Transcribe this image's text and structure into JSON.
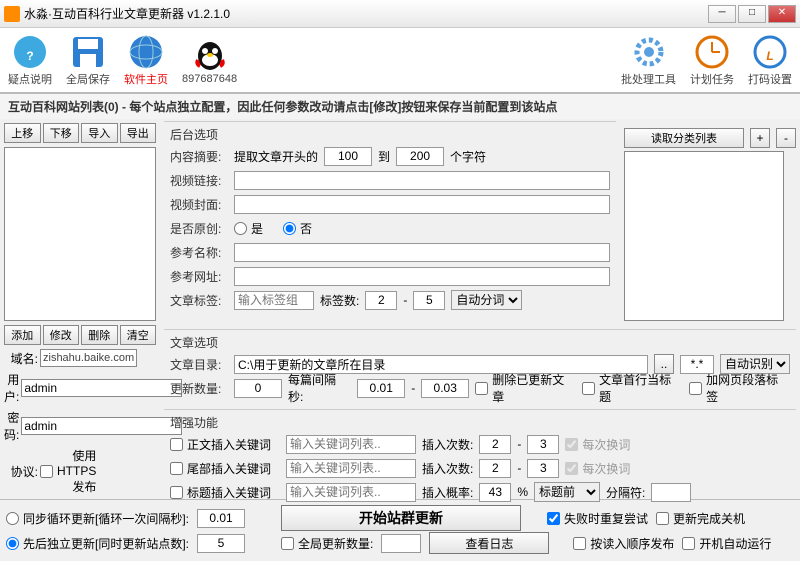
{
  "title": "水淼·互动百科行业文章更新器 v1.2.1.0",
  "toolbar": {
    "help": "疑点说明",
    "save": "全局保存",
    "home": "软件主页",
    "qq": "897687648",
    "batch": "批处理工具",
    "schedule": "计划任务",
    "captcha": "打码设置"
  },
  "subtitle": "互动百科网站列表(0) - 每个站点独立配置，因此任何参数改动请点击[修改]按钮来保存当前配置到该站点",
  "left": {
    "up": "上移",
    "down": "下移",
    "import": "导入",
    "export": "导出",
    "add": "添加",
    "modify": "修改",
    "delete": "删除",
    "clear": "清空",
    "domain_label": "域名:",
    "domain": "zishahu.baike.com",
    "user_label": "用户:",
    "user": "admin",
    "pass_label": "密码:",
    "pass": "admin",
    "proto_label": "协议:",
    "https": "使用 HTTPS 发布"
  },
  "backend": {
    "title": "后台选项",
    "summary_label": "内容摘要:",
    "summary_prefix": "提取文章开头的",
    "summary_to": "到",
    "summary_unit": "个字符",
    "sum_a": "100",
    "sum_b": "200",
    "video_link": "视频链接:",
    "video_cover": "视频封面:",
    "original": "是否原创:",
    "yes": "是",
    "no": "否",
    "ref_name": "参考名称:",
    "ref_url": "参考网址:",
    "tags_label": "文章标签:",
    "tags_ph": "输入标签组",
    "tag_count": "标签数:",
    "tag_a": "2",
    "tag_b": "5",
    "auto_seg": "自动分词",
    "cat_btn": "读取分类列表"
  },
  "article": {
    "title": "文章选项",
    "dir_label": "文章目录:",
    "dir": "C:\\用于更新的文章所在目录",
    "dir_ext": "*.*",
    "auto_detect": "自动识别",
    "count_label": "更新数量:",
    "count": "0",
    "interval_label": "每篇间隔秒:",
    "int_a": "0.01",
    "int_b": "0.03",
    "del_updated": "删除已更新文章",
    "first_title": "文章首行当标题",
    "add_para": "加网页段落标签"
  },
  "enhance": {
    "title": "增强功能",
    "body_kw": "正文插入关键词",
    "tail_kw": "尾部插入关键词",
    "title_kw": "标题插入关键词",
    "kw_ph": "输入关键词列表..",
    "insert_count": "插入次数:",
    "cnt_a": "2",
    "cnt_b": "3",
    "per_line": "每次换词",
    "insert_prob": "插入概率:",
    "prob": "43",
    "before_title": "标题前",
    "sep_label": "分隔符:"
  },
  "bottom": {
    "sync": "同步循环更新[循环一次间隔秒]:",
    "sync_val": "0.01",
    "seq": "先后独立更新[同时更新站点数]:",
    "seq_val": "5",
    "start": "开始站群更新",
    "global_count": "全局更新数量:",
    "viewlog": "查看日志",
    "retry": "失败时重复尝试",
    "shutdown": "更新完成关机",
    "by_import": "按读入顺序发布",
    "autorun": "开机自动运行"
  }
}
